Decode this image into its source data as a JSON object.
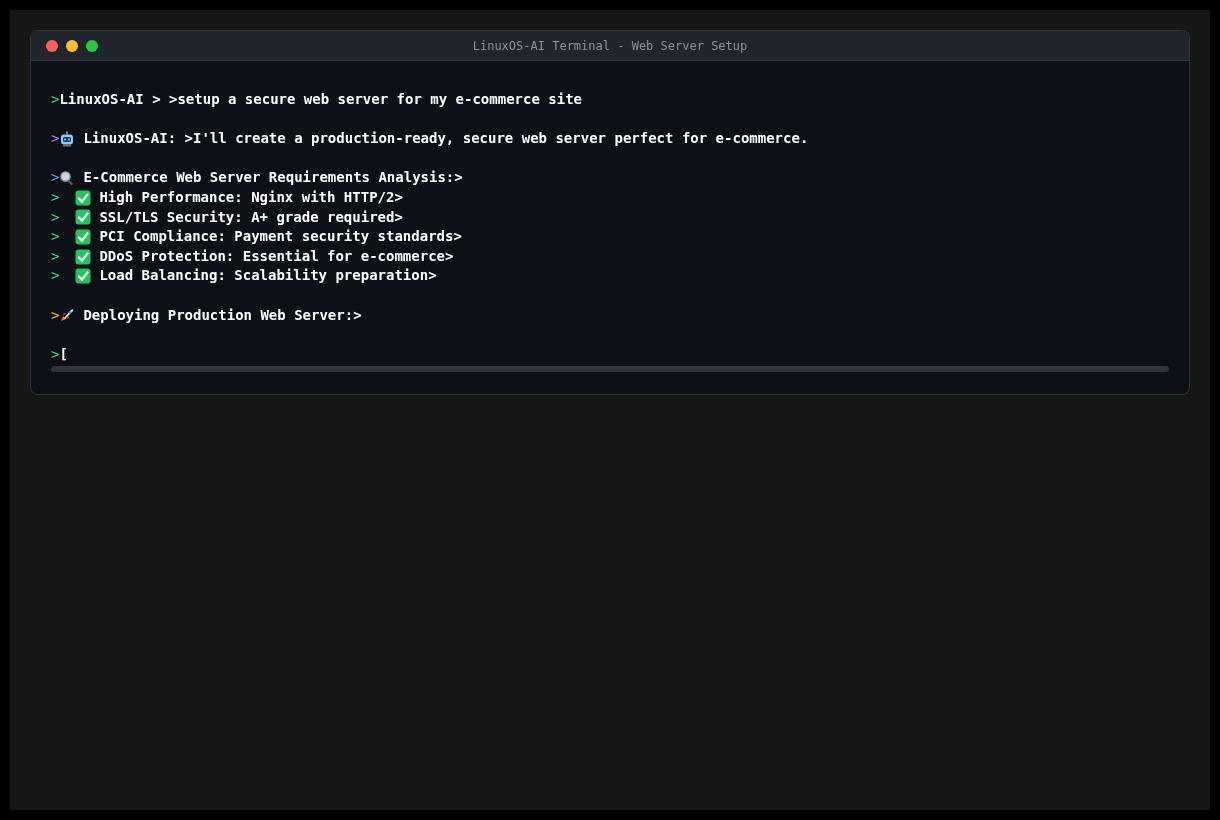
{
  "window": {
    "title": "LinuxOS-AI Terminal - Web Server Setup"
  },
  "blocks": [
    {
      "lines": [
        {
          "kind": "plain",
          "prompt": ">",
          "color": "#4ade80",
          "text": "LinuxOS-AI > >setup a secure web server for my e-commerce site"
        }
      ]
    },
    {
      "lines": [
        {
          "kind": "robot",
          "prompt": ">",
          "color": "#a78bfa",
          "text": "LinuxOS-AI: >I'll create a production-ready, secure web server perfect for e-commerce."
        }
      ]
    },
    {
      "lines": [
        {
          "kind": "magnifier",
          "prompt": ">",
          "color": "#60a5fa",
          "text": "E-Commerce Web Server Requirements Analysis:>"
        },
        {
          "kind": "check",
          "prompt": ">",
          "color": "#4ade80",
          "text": "High Performance: Nginx with HTTP/2>"
        },
        {
          "kind": "check",
          "prompt": ">",
          "color": "#4ade80",
          "text": "SSL/TLS Security: A+ grade required>"
        },
        {
          "kind": "check",
          "prompt": ">",
          "color": "#4ade80",
          "text": "PCI Compliance: Payment security standards>"
        },
        {
          "kind": "check",
          "prompt": ">",
          "color": "#4ade80",
          "text": "DDoS Protection: Essential for e-commerce>"
        },
        {
          "kind": "check",
          "prompt": ">",
          "color": "#4ade80",
          "text": "Load Balancing: Scalability preparation>"
        }
      ]
    },
    {
      "lines": [
        {
          "kind": "rocket",
          "prompt": ">",
          "color": "#facc15",
          "text": "Deploying Production Web Server:>"
        }
      ]
    },
    {
      "lines": [
        {
          "kind": "plain",
          "prompt": ">",
          "color": "#4ade80",
          "text": "["
        }
      ]
    }
  ]
}
